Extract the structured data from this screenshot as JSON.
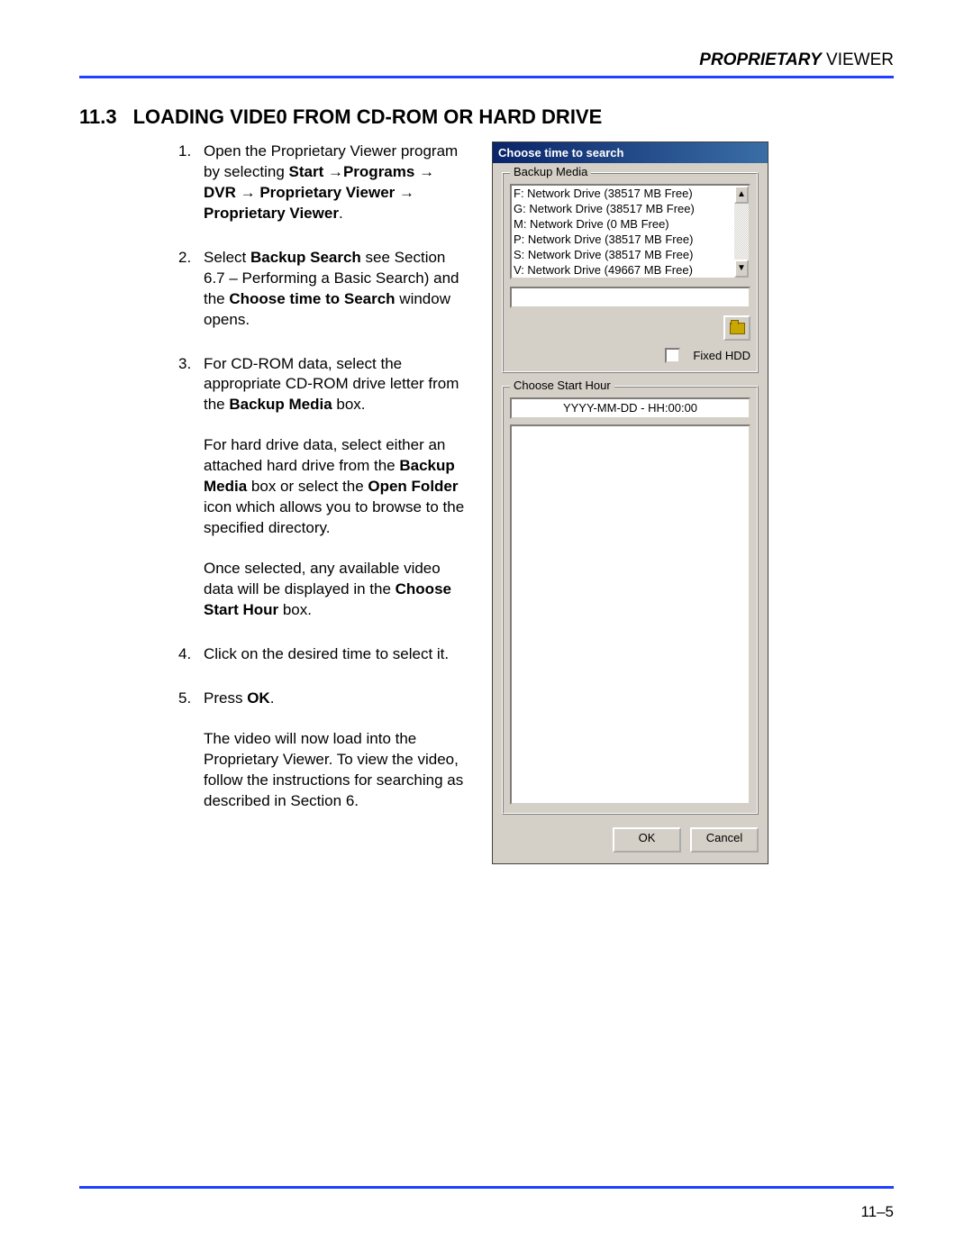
{
  "header": {
    "em": "PROPRIETARY",
    "rest": " VIEWER"
  },
  "section": {
    "number": "11.3",
    "title": "LOADING VIDE0 FROM CD-ROM OR HARD DRIVE"
  },
  "steps": {
    "s1_a": "Open the Proprietary Viewer program by selecting ",
    "s1_b": "Start ",
    "arrow": "→",
    "s1_c": "Programs ",
    "s1_d": " DVR ",
    "s1_e": " Proprietary Viewer ",
    "s1_f": " Proprietary Viewer",
    "s2_a": "Select ",
    "s2_b": "Backup Search",
    "s2_c": " see Section 6.7 – Performing a Basic Search) and the ",
    "s2_d": "Choose time to Search",
    "s2_e": " window opens.",
    "s3_a": "For CD-ROM data, select the appropriate CD-ROM drive letter from the ",
    "s3_b": "Backup Media",
    "s3_c": " box.",
    "s3_p2a": "For hard drive data, select either an attached hard drive from the ",
    "s3_p2b": "Backup Media",
    "s3_p2c": " box or select the ",
    "s3_p2d": "Open Folder",
    "s3_p2e": " icon which allows you to browse to the specified directory.",
    "s3_p3a": "Once selected, any available video data will be displayed in the ",
    "s3_p3b": "Choose Start Hour",
    "s3_p3c": " box.",
    "s4": "Click on the desired time to select it.",
    "s5_a": "Press ",
    "s5_b": "OK",
    "s5_c": ".",
    "s5_p2": "The video will now load into the Proprietary Viewer. To view the video, follow the instructions for searching as described in Section 6."
  },
  "dialog": {
    "title": "Choose time to search",
    "group1": "Backup Media",
    "drives": [
      "F: Network Drive (38517 MB Free)",
      "G: Network Drive (38517 MB Free)",
      "M: Network Drive (0 MB Free)",
      "P: Network Drive (38517 MB Free)",
      "S: Network Drive (38517 MB Free)",
      "V: Network Drive (49667 MB Free)"
    ],
    "fixed_hdd": "Fixed HDD",
    "group2": "Choose Start Hour",
    "hh_placeholder": "YYYY-MM-DD - HH:00:00",
    "ok": "OK",
    "cancel": "Cancel",
    "up": "▲",
    "down": "▼"
  },
  "footer": {
    "page": "11–5"
  }
}
